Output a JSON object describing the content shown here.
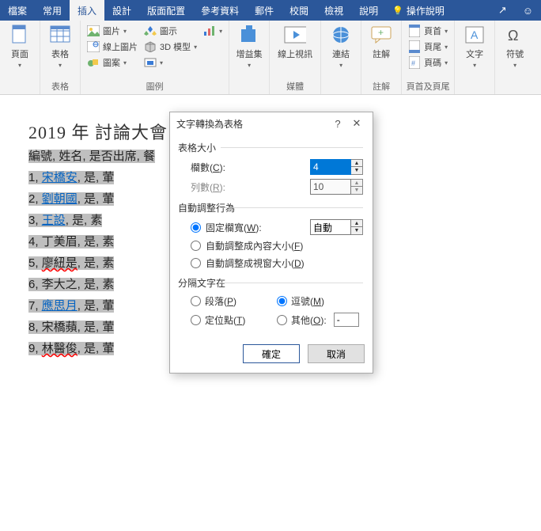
{
  "tabs": {
    "file": "檔案",
    "home": "常用",
    "insert": "插入",
    "design": "設計",
    "layout": "版面配置",
    "references": "參考資料",
    "mail": "郵件",
    "review": "校閱",
    "view": "檢視",
    "help": "說明",
    "tellme": "操作說明"
  },
  "ribbon": {
    "pages": {
      "label": "頁面",
      "page": "頁面"
    },
    "tables": {
      "label": "表格",
      "table": "表格"
    },
    "illustr": {
      "label": "圖例",
      "picture": "圖片",
      "online_pic": "線上圖片",
      "shapes": "圖案",
      "smartart": "圖示",
      "model3d": "3D 模型"
    },
    "addins": {
      "label": "",
      "addins": "增益集"
    },
    "media": {
      "label": "媒體",
      "online_video": "線上視訊"
    },
    "links": {
      "label": "",
      "link": "連結"
    },
    "comments": {
      "label": "註解",
      "comment": "註解"
    },
    "headerfooter": {
      "label": "頁首及頁尾",
      "header": "頁首",
      "footer": "頁尾",
      "pagenum": "頁碼"
    },
    "text": {
      "label": "",
      "text": "文字"
    },
    "symbols": {
      "label": "",
      "symbol": "符號"
    }
  },
  "doc": {
    "title": "2019  年  討論大會",
    "header_row": "編號, 姓名, 是否出席, 餐",
    "rows": [
      {
        "n": "1,",
        "name": "宋橋安",
        "rest": ", 是, 葷"
      },
      {
        "n": "2,",
        "name": "劉朝國",
        "rest": ", 是, 葷"
      },
      {
        "n": "3,",
        "name": "王設",
        "rest": ", 是, 素"
      },
      {
        "n": "4,",
        "name": "丁美眉",
        "rest": ", 是, 素"
      },
      {
        "n": "5,",
        "name": "廖紐是",
        "rest": ", 是, 素"
      },
      {
        "n": "6,",
        "name": "李大之",
        "rest": ", 是, 素"
      },
      {
        "n": "7,",
        "name": "應思月",
        "rest": ", 是, 葷"
      },
      {
        "n": "8,",
        "name": "宋橋蘋",
        "rest": ", 是, 葷"
      },
      {
        "n": "9,",
        "name": "林醫俊",
        "rest": ", 是, 葷"
      }
    ]
  },
  "dialog": {
    "title": "文字轉換為表格",
    "sec_size": "表格大小",
    "cols_label": "欄數(C):",
    "cols_val": "4",
    "rows_label": "列數(R):",
    "rows_val": "10",
    "sec_auto": "自動調整行為",
    "fixed": "固定欄寬(W):",
    "fixed_val": "自動",
    "fit_content": "自動調整成內容大小(F)",
    "fit_window": "自動調整成視窗大小(D)",
    "sec_sep": "分隔文字在",
    "paragraph": "段落(P)",
    "comma": "逗號(M)",
    "tab": "定位點(T)",
    "other": "其他(O):",
    "other_val": "-",
    "ok": "確定",
    "cancel": "取消"
  }
}
